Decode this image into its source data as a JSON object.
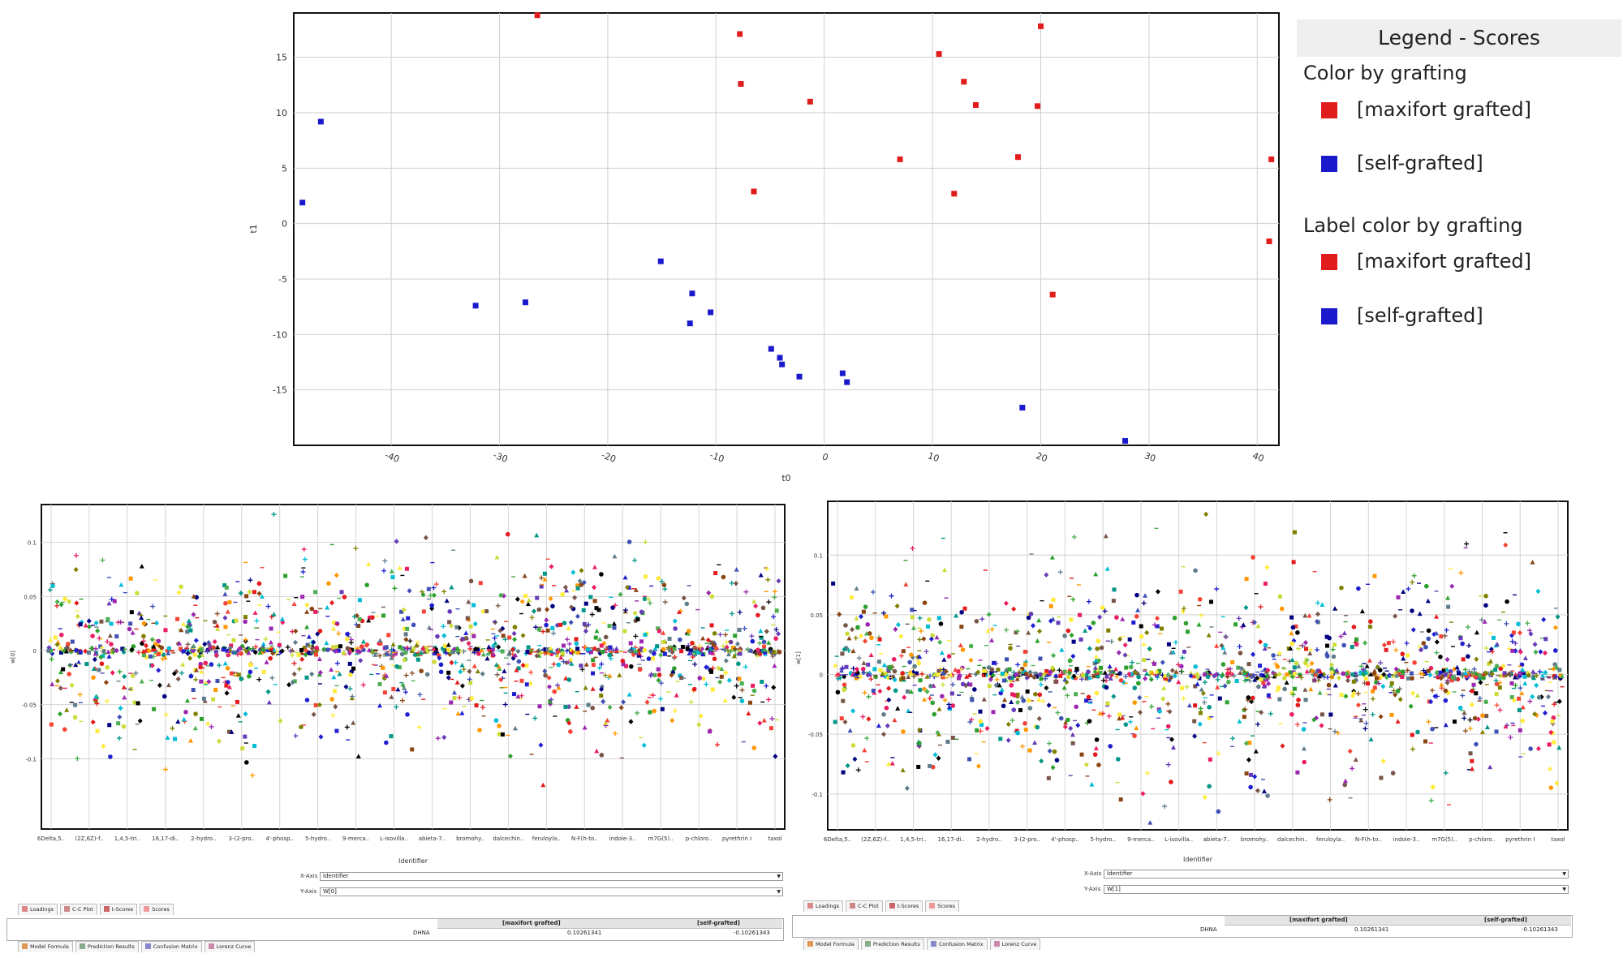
{
  "colors": {
    "maxifort": "#e11c1c",
    "self": "#1a1acc",
    "grid": "#cccccc",
    "plot_border": "#111111"
  },
  "legend": {
    "title": "Legend - Scores",
    "section1": "Color by grafting",
    "section2": "Label color by grafting",
    "items": [
      "[maxifort grafted]",
      "[self-grafted]"
    ]
  },
  "chart_data": [
    {
      "type": "scatter",
      "xlabel": "t0",
      "ylabel": "t1",
      "xlim": [
        -49,
        42
      ],
      "ylim": [
        -20,
        19
      ],
      "xticks": [
        -40,
        -30,
        -20,
        -10,
        0,
        10,
        20,
        30,
        40
      ],
      "yticks": [
        -15,
        -10,
        -5,
        0,
        5,
        10,
        15
      ],
      "grid": true,
      "legend_position": "right",
      "series": [
        {
          "name": "[maxifort grafted]",
          "color": "#e11c1c",
          "points": [
            [
              -26.5,
              18.8
            ],
            [
              -7.8,
              17.1
            ],
            [
              -7.7,
              12.6
            ],
            [
              -6.5,
              2.9
            ],
            [
              -1.3,
              11.0
            ],
            [
              7.0,
              5.8
            ],
            [
              10.6,
              15.3
            ],
            [
              12.0,
              2.7
            ],
            [
              12.9,
              12.8
            ],
            [
              14.0,
              10.7
            ],
            [
              17.9,
              6.0
            ],
            [
              19.7,
              10.6
            ],
            [
              20.0,
              17.8
            ],
            [
              21.1,
              -6.4
            ],
            [
              41.3,
              5.8
            ],
            [
              41.1,
              -1.6
            ]
          ]
        },
        {
          "name": "[self-grafted]",
          "color": "#1a1acc",
          "points": [
            [
              -48.2,
              1.9
            ],
            [
              -46.5,
              9.2
            ],
            [
              -32.2,
              -7.4
            ],
            [
              -27.6,
              -7.1
            ],
            [
              -15.1,
              -3.4
            ],
            [
              -12.2,
              -6.3
            ],
            [
              -12.4,
              -9.0
            ],
            [
              -10.5,
              -8.0
            ],
            [
              -4.9,
              -11.3
            ],
            [
              -4.1,
              -12.1
            ],
            [
              -3.9,
              -12.7
            ],
            [
              -2.3,
              -13.8
            ],
            [
              1.7,
              -13.5
            ],
            [
              2.1,
              -14.3
            ],
            [
              18.3,
              -16.6
            ],
            [
              27.8,
              -19.6
            ]
          ]
        }
      ]
    },
    {
      "type": "scatter",
      "xlabel": "Identifier",
      "ylabel": "w[0]",
      "ylim": [
        -0.165,
        0.135
      ],
      "yticks": [
        "0.1",
        "0.05",
        "0",
        "-0.05",
        "-0.1"
      ],
      "category_ticks": [
        "6Delta,5..",
        "(2Z,6Z)-f..",
        "1,4,5-tri..",
        "16,17-di..",
        "2-hydro..",
        "3-(2-pro..",
        "4'-phosp..",
        "5-hydro..",
        "9-merca..",
        "L-isovilla..",
        "abieta-7..",
        "bromohy..",
        "dalcechin..",
        "feruloyla..",
        "N-F(h-to..",
        "indole-3..",
        "m7G(5)..",
        "p-chloro..",
        "pyrethrin I",
        "taxol"
      ],
      "grid": true,
      "point_count": 1600,
      "x_axis_selector": "Identifier",
      "y_axis_selector": "W[0]"
    },
    {
      "type": "scatter",
      "xlabel": "Identifier",
      "ylabel": "w[1]",
      "ylim": [
        -0.13,
        0.145
      ],
      "yticks": [
        "0.1",
        "0.05",
        "0",
        "-0.05",
        "-0.1"
      ],
      "category_ticks": [
        "6Delta,5..",
        "(2Z,6Z)-f..",
        "1,4,5-tri..",
        "16,17-di..",
        "2-hydro..",
        "3-(2-pro..",
        "4'-phosp..",
        "5-hydro..",
        "9-merca..",
        "L-isovilla..",
        "abieta-7..",
        "bromohy..",
        "dalcechin..",
        "feruloyla..",
        "N-F(h-to..",
        "indole-3..",
        "m7G(5)..",
        "p-chloro..",
        "pyrethrin I",
        "taxol"
      ],
      "grid": true,
      "point_count": 1600,
      "x_axis_selector": "Identifier",
      "y_axis_selector": "W[1]"
    }
  ],
  "panel_ui": {
    "x_axis_label": "X-Axis",
    "y_axis_label": "Y-Axis",
    "view_tabs": [
      "Loadings",
      "C-C Plot",
      "t-Scores",
      "Scores"
    ],
    "bottom_tabs": [
      "Model Formula",
      "Prediction Results",
      "Confusion Matrix",
      "Lorenz Curve"
    ],
    "table": {
      "columns": [
        "[maxifort grafted]",
        "[self-grafted]"
      ],
      "row_label": "DHNA",
      "values": [
        "0.10261341",
        "-0.10261343"
      ]
    }
  }
}
